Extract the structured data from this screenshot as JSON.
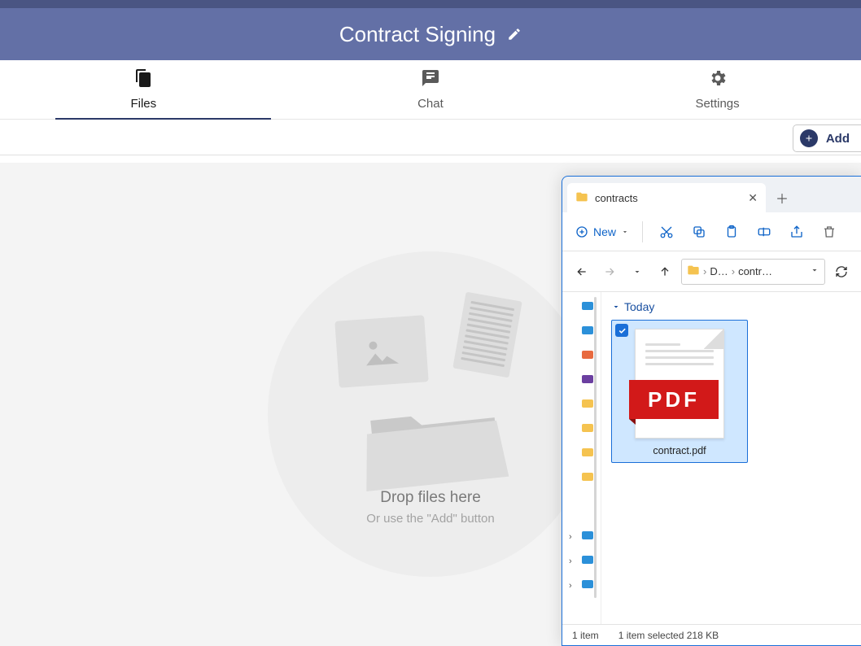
{
  "header": {
    "title": "Contract Signing"
  },
  "tabs": {
    "files": "Files",
    "chat": "Chat",
    "settings": "Settings"
  },
  "add_button": "Add",
  "dropzone": {
    "line1": "Drop files here",
    "line2": "Or use the \"Add\" button"
  },
  "explorer": {
    "tab_title": "contracts",
    "new_button": "New",
    "breadcrumb": {
      "part1": "D…",
      "part2": "contr…"
    },
    "group": "Today",
    "file": {
      "name": "contract.pdf",
      "badge": "PDF"
    },
    "status": {
      "count": "1 item",
      "selected": "1 item selected  218 KB"
    }
  }
}
